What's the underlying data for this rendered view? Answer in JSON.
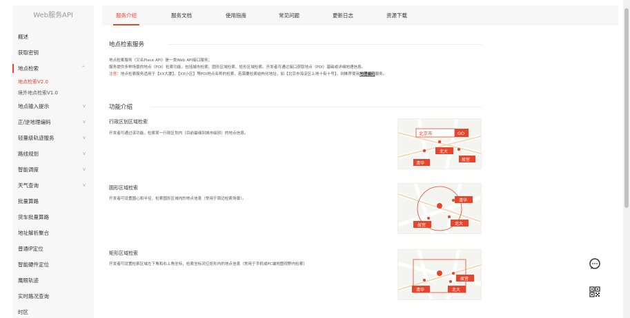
{
  "colors": {
    "accent": "#e8442b",
    "sidebar_bg": "#f7f7f7",
    "text": "#333333",
    "muted": "#555555"
  },
  "sidebar": {
    "title": "Web服务API",
    "items": [
      {
        "label": "概述",
        "chevron": ""
      },
      {
        "label": "获取密钥",
        "chevron": ""
      },
      {
        "label": "地点检索",
        "chevron": "^",
        "active": true,
        "sub": [
          {
            "label": "地点检索V2.0",
            "active": true
          },
          {
            "label": "境外地点检索V1.0"
          }
        ]
      },
      {
        "label": "地点输入提示",
        "chevron": "v"
      },
      {
        "label": "正/逆地理编码",
        "chevron": "v"
      },
      {
        "label": "轻量级轨迹服务",
        "chevron": "v"
      },
      {
        "label": "路线规划",
        "chevron": "v"
      },
      {
        "label": "智能调度",
        "chevron": "v"
      },
      {
        "label": "天气查询",
        "chevron": "v"
      },
      {
        "label": "批量算路",
        "chevron": ""
      },
      {
        "label": "货车批量算路",
        "chevron": ""
      },
      {
        "label": "地址解析聚合",
        "chevron": ""
      },
      {
        "label": "普通IP定位",
        "chevron": ""
      },
      {
        "label": "智能硬件定位",
        "chevron": ""
      },
      {
        "label": "鹰眼轨迹",
        "chevron": ""
      },
      {
        "label": "实时路况查询",
        "chevron": ""
      },
      {
        "label": "时区",
        "chevron": ""
      }
    ]
  },
  "tabs": [
    {
      "label": "服务介绍",
      "active": true
    },
    {
      "label": "服务文档"
    },
    {
      "label": "使用指南"
    },
    {
      "label": "常见问题"
    },
    {
      "label": "更新日志"
    },
    {
      "label": "资源下载"
    }
  ],
  "content": {
    "title": "地点检索服务",
    "intro1": "地点检索服务（又名Place API）是一类Web API接口服务；",
    "intro2": "服务提供多种场景的地点（POI）检索功能，包括城市检索、圆形区域检索、矩形区域检索。开发者可通过接口获取地点（POI）基础或详细地理信息。",
    "note_label": "注意：",
    "note_text": "地点检索服务适用于【XX大厦】、【XX小区】等POI地点名称的检索，若需要检索结构化地址，如【北京市海淀区上地十街十号】，则推荐使用",
    "note_link": "地理编码",
    "note_tail": "服务。",
    "features_title": "功能介绍",
    "features": [
      {
        "title": "行政区划区域检索",
        "desc": "开发者可通过该功能，检索某一行政区划内（目前最细到城市级别）的地点信息。",
        "image": {
          "search_text": "北京市",
          "button": "GO",
          "pins": [
            "北大",
            "清华",
            "故宫"
          ]
        }
      },
      {
        "title": "圆形区域检索",
        "desc": "开发者可设置圆心和半径，检索圆形区域内的地点信息（常用于周边检索场景）。",
        "image": {
          "pins": [
            "清华",
            "故宫",
            "北大"
          ]
        }
      },
      {
        "title": "矩形区域检索",
        "desc": "开发者可设置检索区域左下角和右上角坐标，检索坐标对应矩形内的地点信息（常用于手机或PC端地图视野内检索）",
        "image": {
          "pins": [
            "故宫",
            "清华",
            "北大"
          ]
        }
      },
      {
        "title": "",
        "desc": ""
      }
    ]
  },
  "floating": {
    "chat_icon": "chat-bubble-icon",
    "qr_icon": "qr-code-icon"
  }
}
